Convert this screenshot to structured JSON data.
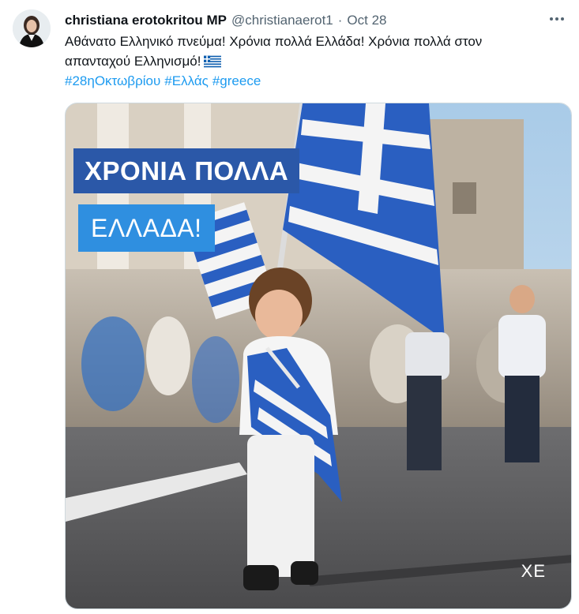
{
  "author": {
    "name": "christiana erotokritou MP",
    "handle": "@christianaerot1",
    "separator": "·",
    "date": "Oct 28"
  },
  "tweet": {
    "text": "Αθάνατο Ελληνικό πνεύμα! Χρόνια πολλά Ελλάδα! Χρόνια πολλά στον απανταχού Ελληνισμό!",
    "flag_icon": "greek-flag-emoji",
    "hashtags": [
      "#28ηΟκτωβρίου",
      "#Ελλάς",
      "#greece"
    ]
  },
  "media": {
    "banner_line1": "ΧΡΟΝΙΑ ΠΟΛΛΑ",
    "banner_line2": "ΕΛΛΑΔΑ!",
    "watermark": "ΧΕ"
  },
  "colors": {
    "link": "#1d9bf0",
    "banner_dark": "#2b58a8",
    "banner_light": "#2f8fe0",
    "flag_blue": "#2a5fc1"
  }
}
